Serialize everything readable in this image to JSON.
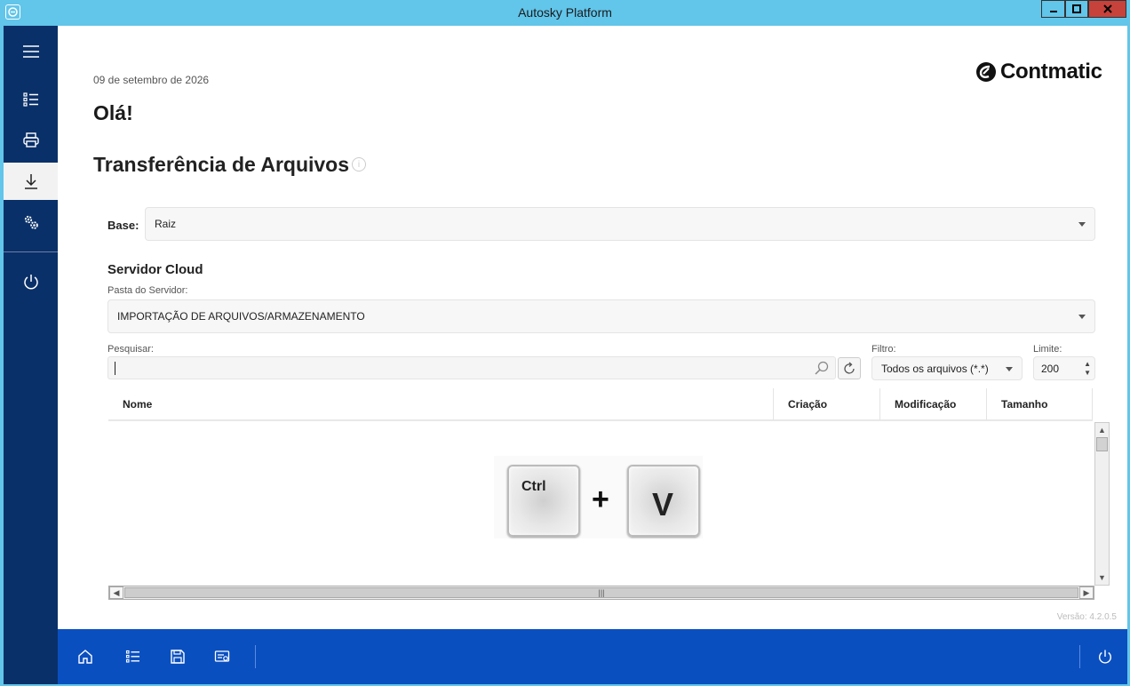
{
  "window": {
    "title": "Autosky Platform",
    "minimize_label": "▁",
    "maximize_label": "□",
    "close_label": "✕"
  },
  "sidebar": {
    "items": [
      {
        "icon": "menu-icon"
      },
      {
        "icon": "list-icon"
      },
      {
        "icon": "printer-icon"
      },
      {
        "icon": "download-icon",
        "active": true
      },
      {
        "icon": "settings-icon"
      },
      {
        "icon": "power-icon"
      }
    ]
  },
  "header": {
    "date": "09 de setembro de 2026",
    "greeting": "Olá!",
    "logo_text": "Contmatic"
  },
  "section": {
    "title": "Transferência de Arquivos",
    "info_icon": "i"
  },
  "base": {
    "label": "Base:",
    "value": "Raiz"
  },
  "cloud": {
    "title": "Servidor Cloud",
    "folder_label": "Pasta do Servidor:",
    "folder_value": "IMPORTAÇÃO DE ARQUIVOS/ARMAZENAMENTO",
    "search_label": "Pesquisar:",
    "search_value": "",
    "filter_label": "Filtro:",
    "filter_value": "Todos os arquivos (*.*)",
    "limit_label": "Limite:",
    "limit_value": "200"
  },
  "table": {
    "columns": [
      "Nome",
      "Criação",
      "Modificação",
      "Tamanho"
    ],
    "rows": []
  },
  "overlay": {
    "key1": "Ctrl",
    "plus": "+",
    "key2": "V"
  },
  "footer": {
    "version": "Versão: 4.2.0.5"
  },
  "bottombar": {
    "items": [
      "home-icon",
      "list-icon",
      "save-icon",
      "certificate-icon",
      "power-icon"
    ]
  },
  "colors": {
    "titlebar": "#62c5ea",
    "sidebar": "#0a3069",
    "bottombar": "#0a4fc0",
    "close_button": "#c7423b"
  }
}
